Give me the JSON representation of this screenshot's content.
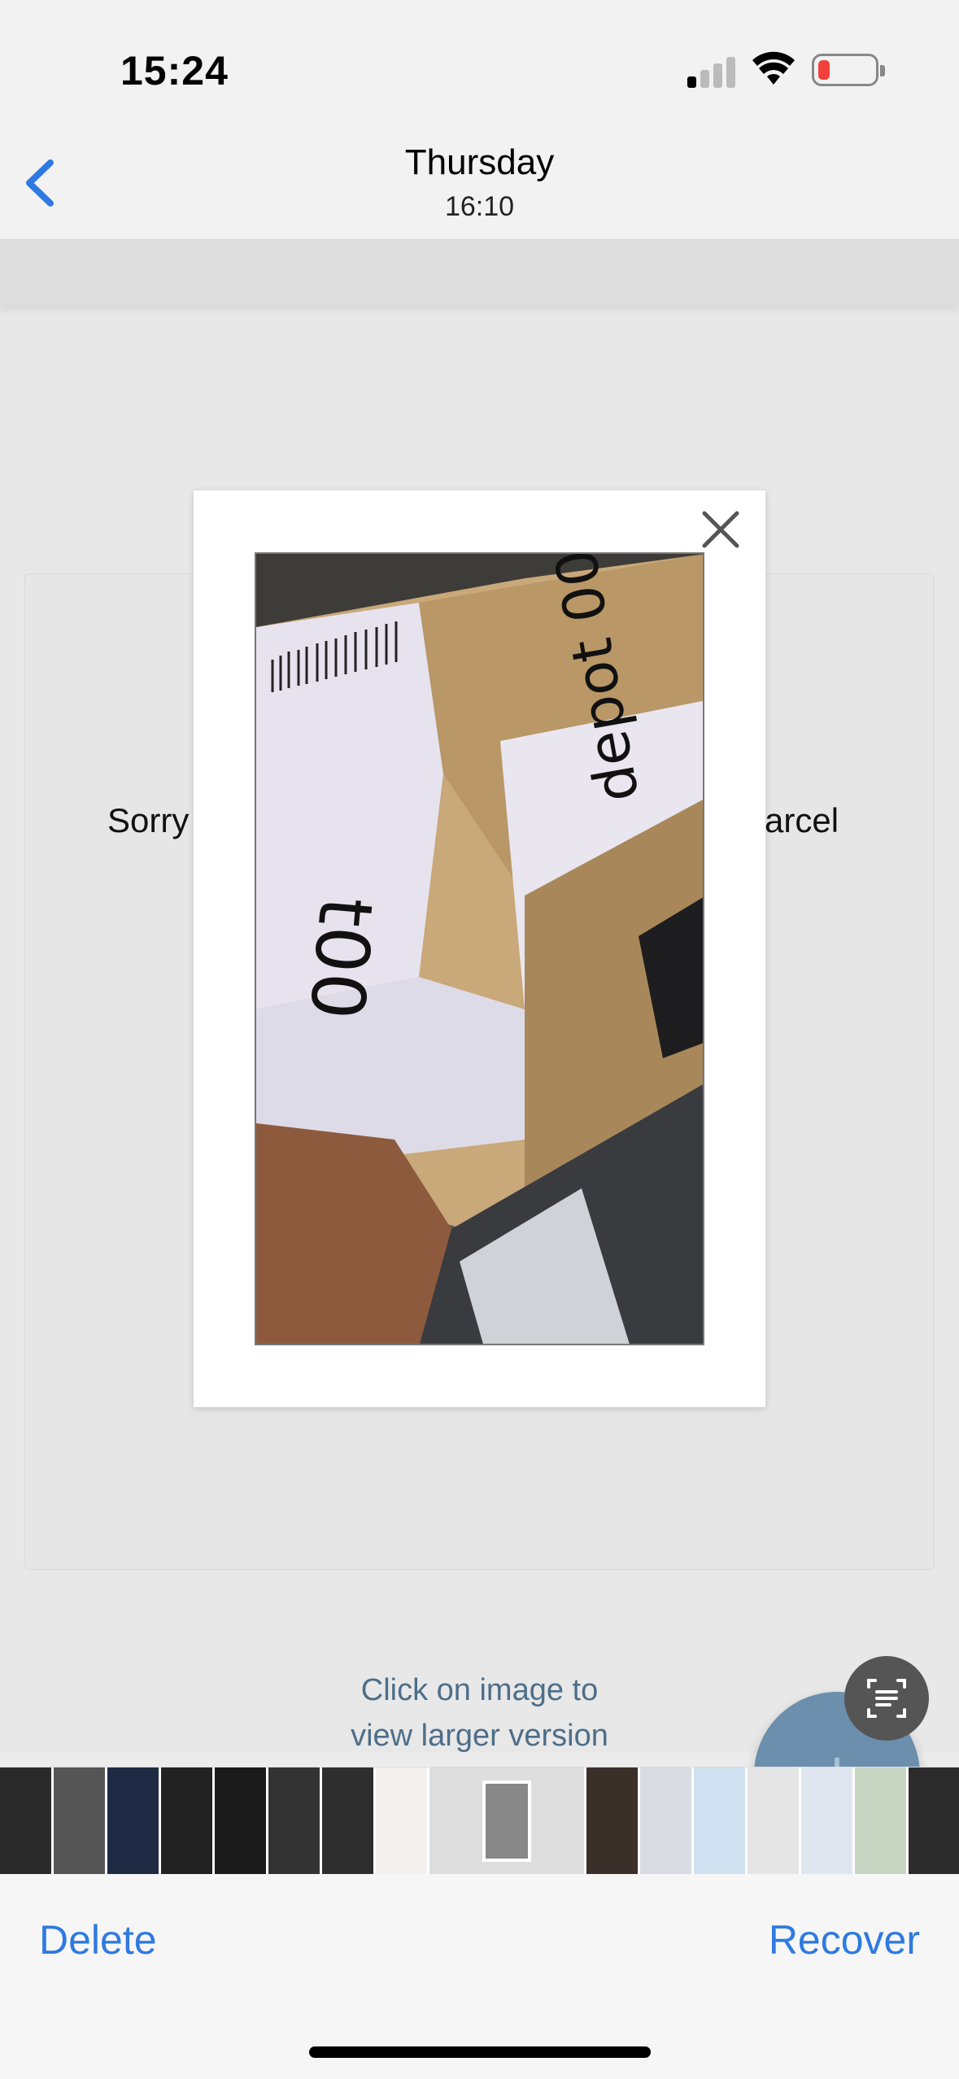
{
  "status_bar": {
    "time": "15:24"
  },
  "nav": {
    "title": "Thursday",
    "subtitle": "16:10"
  },
  "background_page": {
    "partial_text_left": "Sorry",
    "partial_text_right": "arcel",
    "hint_line1": "Click on image to",
    "hint_line2": "view larger version",
    "fab_label": "+"
  },
  "toolbar": {
    "delete_label": "Delete",
    "recover_label": "Recover"
  },
  "colors": {
    "accent": "#2f7ae0",
    "fab": "#6b8fad",
    "battery_low": "#f2413c"
  }
}
